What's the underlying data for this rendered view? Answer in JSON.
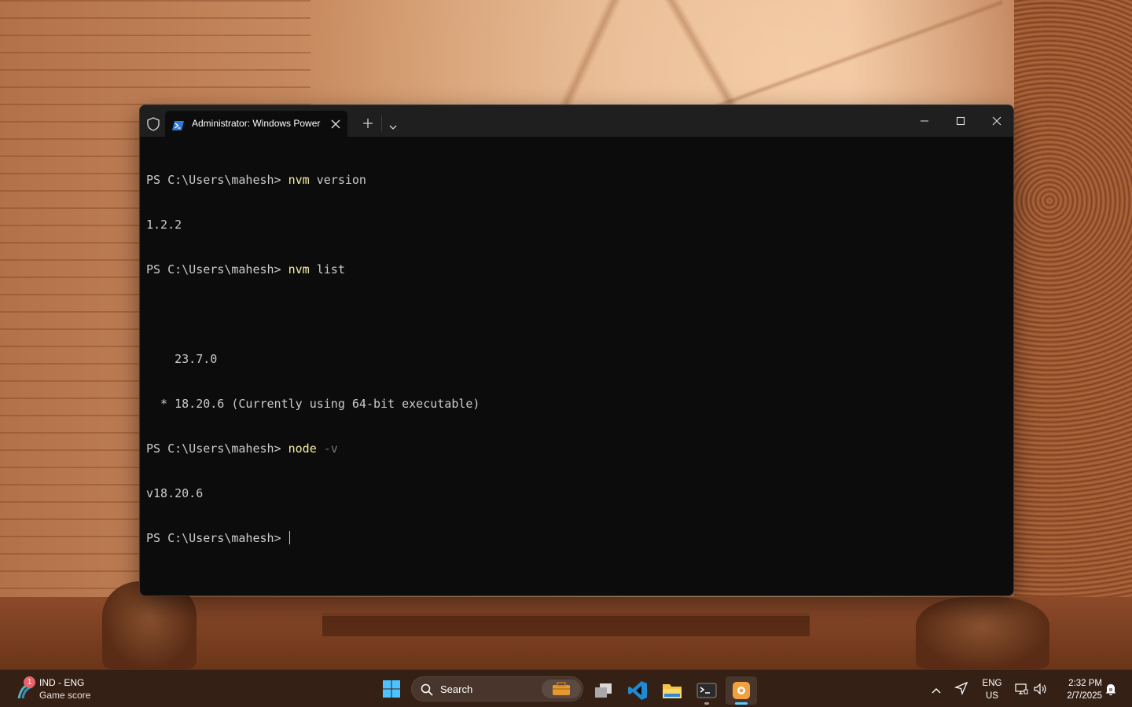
{
  "window": {
    "tab_title": "Administrator: Windows PowerShell",
    "icons": {
      "shield": "shield-icon",
      "tab": "powershell-icon",
      "close_tab": "close-icon",
      "new_tab": "plus-icon",
      "dropdown": "chevron-down-icon",
      "minimize": "minimize-icon",
      "maximize": "maximize-icon",
      "close": "close-icon"
    }
  },
  "console": {
    "lines": [
      {
        "prompt": "PS C:\\Users\\mahesh> ",
        "cmd": "nvm",
        "arg": " version",
        "param": "",
        "output": ""
      },
      {
        "prompt": "",
        "cmd": "",
        "arg": "",
        "param": "",
        "output": "1.2.2"
      },
      {
        "prompt": "PS C:\\Users\\mahesh> ",
        "cmd": "nvm",
        "arg": " list",
        "param": "",
        "output": ""
      },
      {
        "prompt": "",
        "cmd": "",
        "arg": "",
        "param": "",
        "output": ""
      },
      {
        "prompt": "",
        "cmd": "",
        "arg": "",
        "param": "",
        "output": "    23.7.0"
      },
      {
        "prompt": "",
        "cmd": "",
        "arg": "",
        "param": "",
        "output": "  * 18.20.6 (Currently using 64-bit executable)"
      },
      {
        "prompt": "PS C:\\Users\\mahesh> ",
        "cmd": "node",
        "arg": " ",
        "param": "-v",
        "output": ""
      },
      {
        "prompt": "",
        "cmd": "",
        "arg": "",
        "param": "",
        "output": "v18.20.6"
      },
      {
        "prompt": "PS C:\\Users\\mahesh> ",
        "cmd": "",
        "arg": "",
        "param": "",
        "output": ""
      }
    ]
  },
  "taskbar": {
    "widget": {
      "badge": "1",
      "title": "IND - ENG",
      "subtitle": "Game score",
      "icon": "cricket-icon"
    },
    "search_label": "Search",
    "apps": [
      {
        "name": "windows-start-icon"
      },
      {
        "name": "briefcase-icon"
      },
      {
        "name": "task-view-icon"
      },
      {
        "name": "vscode-icon"
      },
      {
        "name": "file-explorer-icon"
      },
      {
        "name": "terminal-icon"
      },
      {
        "name": "camera-app-icon"
      }
    ],
    "tray": {
      "lang_line1": "ENG",
      "lang_line2": "US",
      "time": "2:32 PM",
      "date": "2/7/2025"
    }
  },
  "colors": {
    "accent": "#60cdff",
    "terminal_bg": "#0c0c0c",
    "command_yellow": "#f9f1a5",
    "param_gray": "#767676",
    "text": "#cccccc"
  }
}
